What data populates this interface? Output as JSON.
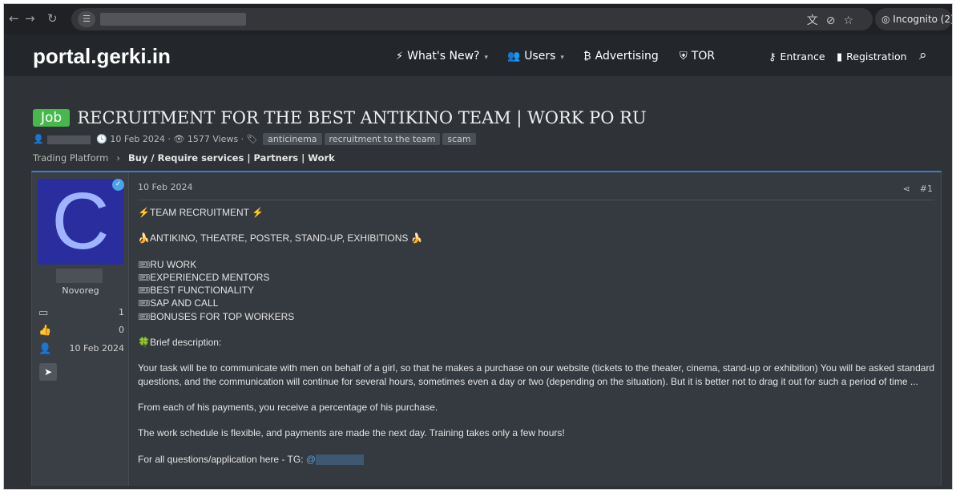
{
  "browser": {
    "incognito_label": "Incognito (2)",
    "icons": [
      "back-arrow-icon",
      "forward-arrow-icon",
      "reload-icon",
      "site-info-icon",
      "translate-icon",
      "eye-off-icon",
      "star-icon",
      "incognito-icon"
    ]
  },
  "site": {
    "logo": "portal.gerki.in",
    "nav": {
      "whats_new": "What's New?",
      "users": "Users",
      "advertising": "Advertising",
      "tor": "TOR",
      "entrance": "Entrance",
      "registration": "Registration"
    }
  },
  "thread": {
    "prefix": "Job",
    "title": "RECRUITMENT FOR THE BEST ANTIKINO TEAM | WORK PO RU",
    "date": "10 Feb 2024",
    "views": "1577 Views",
    "tags": [
      "anticinema",
      "recruitment to the team",
      "scam"
    ]
  },
  "breadcrumb": {
    "root": "Trading Platform",
    "current": "Buy / Require services | Partners | Work"
  },
  "post": {
    "user_title": "Novoreg",
    "messages": "1",
    "reactions": "0",
    "joined": "10 Feb 2024",
    "date": "10 Feb 2024",
    "number": "#1",
    "lines": {
      "heading": "⚡TEAM RECRUITMENT ⚡",
      "genres": "🍌ANTIKINO, THEATRE, POSTER, STAND-UP, EXHIBITIONS 🍌",
      "features": [
        "RU WORK",
        "EXPERIENCED MENTORS",
        "BEST FUNCTIONALITY",
        "SAP AND CALL",
        "BONUSES FOR TOP WORKERS"
      ],
      "brief": "🍀Brief description:",
      "p1": "Your task will be to communicate with men on behalf of a girl, so that he makes a purchase on our website (tickets to the theater, cinema, stand-up or exhibition) You will be asked standard questions, and the communication will continue for several hours, sometimes even a day or two (depending on the situation). But it is better not to drag it out for such a period of time ...",
      "p2": "From each of his payments, you receive a percentage of his purchase.",
      "p3": "The work schedule is flexible, and payments are made the next day. Training takes only a few hours!",
      "p4": "For all questions/application here - TG:",
      "mention_prefix": "@"
    }
  },
  "colors": {
    "job_badge": "#47b84b",
    "accent": "#3c7ec3",
    "avatar_bg": "#2a2d9e"
  }
}
